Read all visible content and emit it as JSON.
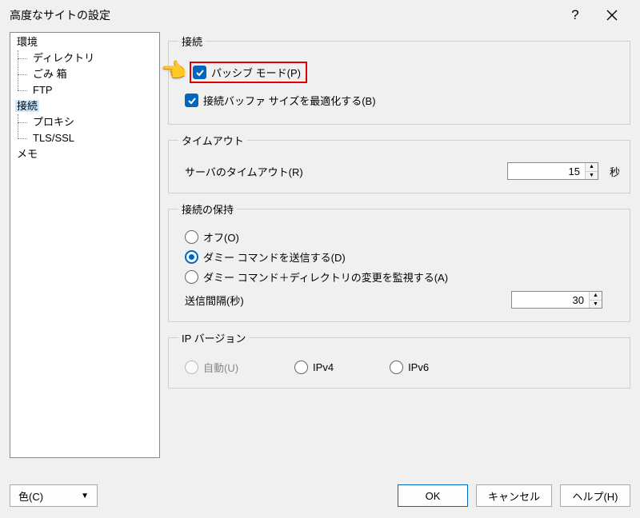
{
  "window": {
    "title": "高度なサイトの設定"
  },
  "tree": {
    "nodes": [
      {
        "label": "環境",
        "children": [
          {
            "label": "ディレクトリ"
          },
          {
            "label": "ごみ 箱"
          },
          {
            "label": "FTP"
          }
        ]
      },
      {
        "label": "接続",
        "selected": true,
        "children": [
          {
            "label": "プロキシ"
          },
          {
            "label": "TLS/SSL"
          }
        ]
      },
      {
        "label": "メモ"
      }
    ]
  },
  "groups": {
    "connection": {
      "legend": "接続",
      "passive_mode": "パッシブ モード(P)",
      "optimize_buffer": "接続バッファ サイズを最適化する(B)"
    },
    "timeout": {
      "legend": "タイムアウト",
      "server_timeout_label": "サーバのタイムアウト(R)",
      "server_timeout_value": "15",
      "unit_seconds": "秒"
    },
    "keepalive": {
      "legend": "接続の保持",
      "off": "オフ(O)",
      "dummy": "ダミー コマンドを送信する(D)",
      "dummy_dir": "ダミー コマンド＋ディレクトリの変更を監視する(A)",
      "interval_label": "送信間隔(秒)",
      "interval_value": "30"
    },
    "ip": {
      "legend": "IP バージョン",
      "auto": "自動(U)",
      "v4": "IPv4",
      "v6": "IPv6"
    }
  },
  "footer": {
    "color": "色(C)",
    "ok": "OK",
    "cancel": "キャンセル",
    "help": "ヘルプ(H)"
  }
}
